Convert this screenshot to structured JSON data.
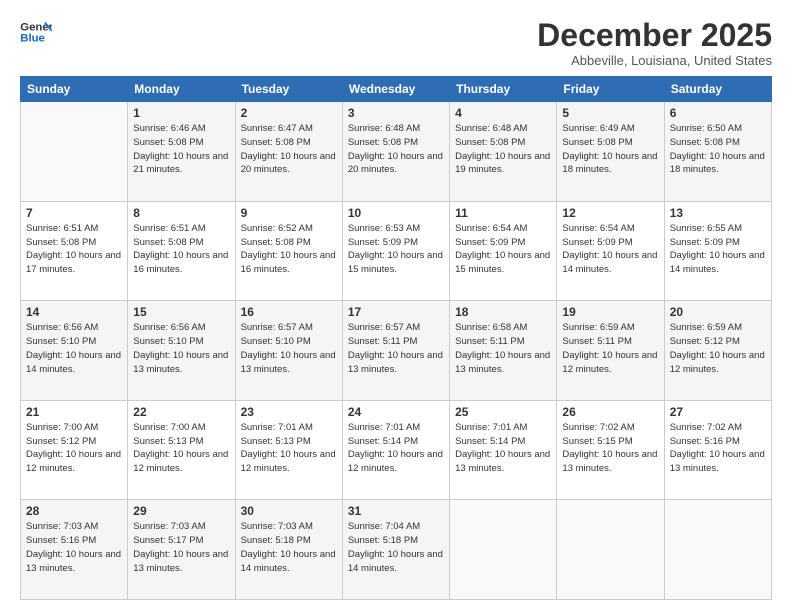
{
  "header": {
    "logo_line1": "General",
    "logo_line2": "Blue",
    "month": "December 2025",
    "location": "Abbeville, Louisiana, United States"
  },
  "days_of_week": [
    "Sunday",
    "Monday",
    "Tuesday",
    "Wednesday",
    "Thursday",
    "Friday",
    "Saturday"
  ],
  "weeks": [
    [
      {
        "day": "",
        "info": ""
      },
      {
        "day": "1",
        "info": "Sunrise: 6:46 AM\nSunset: 5:08 PM\nDaylight: 10 hours\nand 21 minutes."
      },
      {
        "day": "2",
        "info": "Sunrise: 6:47 AM\nSunset: 5:08 PM\nDaylight: 10 hours\nand 20 minutes."
      },
      {
        "day": "3",
        "info": "Sunrise: 6:48 AM\nSunset: 5:08 PM\nDaylight: 10 hours\nand 20 minutes."
      },
      {
        "day": "4",
        "info": "Sunrise: 6:48 AM\nSunset: 5:08 PM\nDaylight: 10 hours\nand 19 minutes."
      },
      {
        "day": "5",
        "info": "Sunrise: 6:49 AM\nSunset: 5:08 PM\nDaylight: 10 hours\nand 18 minutes."
      },
      {
        "day": "6",
        "info": "Sunrise: 6:50 AM\nSunset: 5:08 PM\nDaylight: 10 hours\nand 18 minutes."
      }
    ],
    [
      {
        "day": "7",
        "info": ""
      },
      {
        "day": "8",
        "info": "Sunrise: 6:51 AM\nSunset: 5:08 PM\nDaylight: 10 hours\nand 16 minutes."
      },
      {
        "day": "9",
        "info": "Sunrise: 6:52 AM\nSunset: 5:08 PM\nDaylight: 10 hours\nand 16 minutes."
      },
      {
        "day": "10",
        "info": "Sunrise: 6:53 AM\nSunset: 5:09 PM\nDaylight: 10 hours\nand 15 minutes."
      },
      {
        "day": "11",
        "info": "Sunrise: 6:54 AM\nSunset: 5:09 PM\nDaylight: 10 hours\nand 15 minutes."
      },
      {
        "day": "12",
        "info": "Sunrise: 6:54 AM\nSunset: 5:09 PM\nDaylight: 10 hours\nand 14 minutes."
      },
      {
        "day": "13",
        "info": "Sunrise: 6:55 AM\nSunset: 5:09 PM\nDaylight: 10 hours\nand 14 minutes."
      }
    ],
    [
      {
        "day": "14",
        "info": ""
      },
      {
        "day": "15",
        "info": "Sunrise: 6:56 AM\nSunset: 5:10 PM\nDaylight: 10 hours\nand 13 minutes."
      },
      {
        "day": "16",
        "info": "Sunrise: 6:57 AM\nSunset: 5:10 PM\nDaylight: 10 hours\nand 13 minutes."
      },
      {
        "day": "17",
        "info": "Sunrise: 6:57 AM\nSunset: 5:11 PM\nDaylight: 10 hours\nand 13 minutes."
      },
      {
        "day": "18",
        "info": "Sunrise: 6:58 AM\nSunset: 5:11 PM\nDaylight: 10 hours\nand 13 minutes."
      },
      {
        "day": "19",
        "info": "Sunrise: 6:59 AM\nSunset: 5:11 PM\nDaylight: 10 hours\nand 12 minutes."
      },
      {
        "day": "20",
        "info": "Sunrise: 6:59 AM\nSunset: 5:12 PM\nDaylight: 10 hours\nand 12 minutes."
      }
    ],
    [
      {
        "day": "21",
        "info": ""
      },
      {
        "day": "22",
        "info": "Sunrise: 7:00 AM\nSunset: 5:13 PM\nDaylight: 10 hours\nand 12 minutes."
      },
      {
        "day": "23",
        "info": "Sunrise: 7:01 AM\nSunset: 5:13 PM\nDaylight: 10 hours\nand 12 minutes."
      },
      {
        "day": "24",
        "info": "Sunrise: 7:01 AM\nSunset: 5:14 PM\nDaylight: 10 hours\nand 12 minutes."
      },
      {
        "day": "25",
        "info": "Sunrise: 7:01 AM\nSunset: 5:14 PM\nDaylight: 10 hours\nand 13 minutes."
      },
      {
        "day": "26",
        "info": "Sunrise: 7:02 AM\nSunset: 5:15 PM\nDaylight: 10 hours\nand 13 minutes."
      },
      {
        "day": "27",
        "info": "Sunrise: 7:02 AM\nSunset: 5:16 PM\nDaylight: 10 hours\nand 13 minutes."
      }
    ],
    [
      {
        "day": "28",
        "info": "Sunrise: 7:03 AM\nSunset: 5:16 PM\nDaylight: 10 hours\nand 13 minutes."
      },
      {
        "day": "29",
        "info": "Sunrise: 7:03 AM\nSunset: 5:17 PM\nDaylight: 10 hours\nand 13 minutes."
      },
      {
        "day": "30",
        "info": "Sunrise: 7:03 AM\nSunset: 5:18 PM\nDaylight: 10 hours\nand 14 minutes."
      },
      {
        "day": "31",
        "info": "Sunrise: 7:04 AM\nSunset: 5:18 PM\nDaylight: 10 hours\nand 14 minutes."
      },
      {
        "day": "",
        "info": ""
      },
      {
        "day": "",
        "info": ""
      },
      {
        "day": "",
        "info": ""
      }
    ]
  ],
  "week7_sunday": {
    "info": "Sunrise: 6:51 AM\nSunset: 5:08 PM\nDaylight: 10 hours\nand 17 minutes."
  },
  "week14_sunday": {
    "info": "Sunrise: 6:56 AM\nSunset: 5:10 PM\nDaylight: 10 hours\nand 14 minutes."
  },
  "week21_sunday": {
    "info": "Sunrise: 7:00 AM\nSunset: 5:12 PM\nDaylight: 10 hours\nand 12 minutes."
  }
}
